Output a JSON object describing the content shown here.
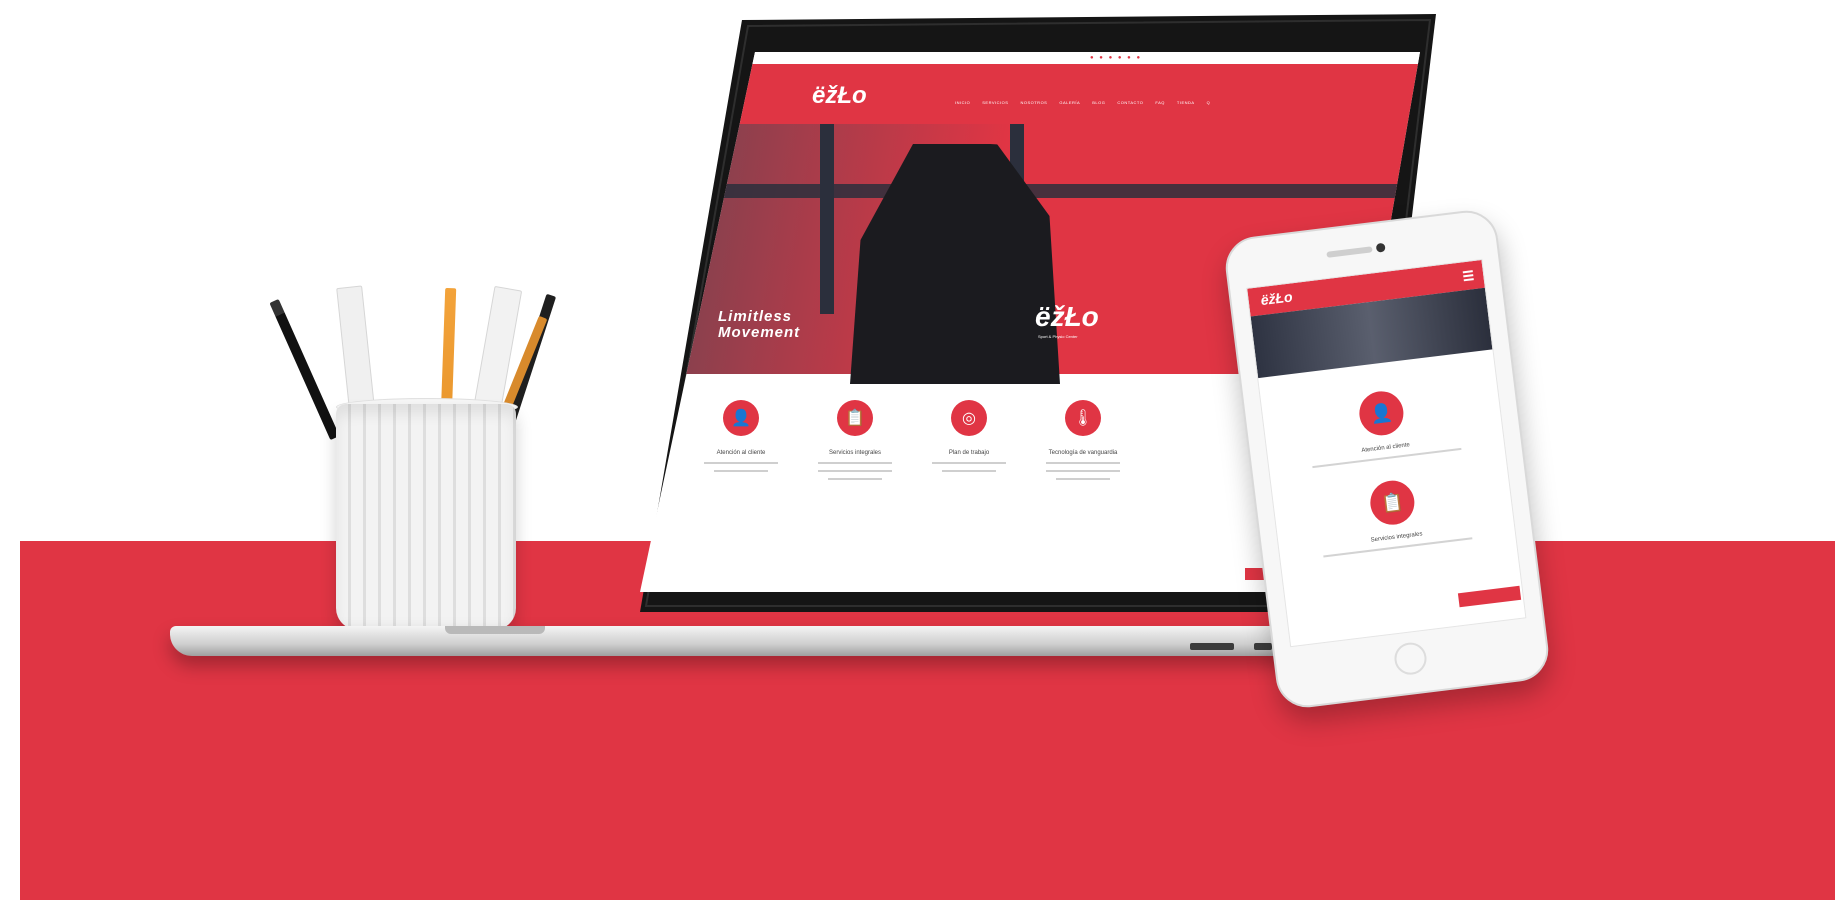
{
  "scene": {
    "description_visible": false
  },
  "laptop_site": {
    "logo": "ëžŁo",
    "nav_items": [
      "INICIO",
      "SERVICIOS",
      "NOSOTROS",
      "GALERÍA",
      "BLOG",
      "CONTACTO",
      "FAQ",
      "TIENDA",
      "Q"
    ],
    "tagline_line1": "Limitless",
    "tagline_line2": "Movement",
    "hero_logo": "ëžŁo",
    "hero_logo_sub": "Sport & Physio Center",
    "features": [
      {
        "icon": "person-icon",
        "glyph": "👤",
        "title": "Atención al cliente"
      },
      {
        "icon": "clipboard-icon",
        "glyph": "📋",
        "title": "Servicios integrales"
      },
      {
        "icon": "target-icon",
        "glyph": "◎",
        "title": "Plan de trabajo"
      },
      {
        "icon": "thermometer-icon",
        "glyph": "🌡",
        "title": "Tecnología de vanguardia"
      }
    ]
  },
  "phone_site": {
    "logo": "ëžŁo",
    "features": [
      {
        "icon": "person-icon",
        "glyph": "👤",
        "title": "Atención al cliente"
      },
      {
        "icon": "clipboard-icon",
        "glyph": "📋",
        "title": "Servicios integrales"
      }
    ]
  },
  "colors": {
    "brand_red": "#e03544",
    "dark": "#1b1b1f"
  }
}
